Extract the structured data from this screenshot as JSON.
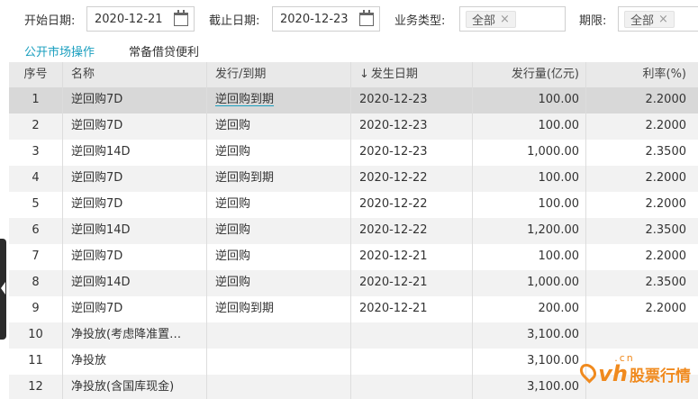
{
  "filters": {
    "start_label": "开始日期:",
    "start_value": "2020-12-21",
    "end_label": "截止日期:",
    "end_value": "2020-12-23",
    "type_label": "业务类型:",
    "type_tag": "全部",
    "term_label": "期限:",
    "term_tag": "全部",
    "tag_remove": "×"
  },
  "tabs": [
    "公开市场操作",
    "常备借贷便利"
  ],
  "table": {
    "sort_arrow": "↓",
    "columns": [
      "序号",
      "名称",
      "发行/到期",
      "发生日期",
      "发行量(亿元)",
      "利率(%)"
    ],
    "rows": [
      [
        "1",
        "逆回购7D",
        "逆回购到期",
        "2020-12-23",
        "100.00",
        "2.2000"
      ],
      [
        "2",
        "逆回购7D",
        "逆回购",
        "2020-12-23",
        "100.00",
        "2.2000"
      ],
      [
        "3",
        "逆回购14D",
        "逆回购",
        "2020-12-23",
        "1,000.00",
        "2.3500"
      ],
      [
        "4",
        "逆回购7D",
        "逆回购到期",
        "2020-12-22",
        "100.00",
        "2.2000"
      ],
      [
        "5",
        "逆回购7D",
        "逆回购",
        "2020-12-22",
        "100.00",
        "2.2000"
      ],
      [
        "6",
        "逆回购14D",
        "逆回购",
        "2020-12-22",
        "1,200.00",
        "2.3500"
      ],
      [
        "7",
        "逆回购7D",
        "逆回购",
        "2020-12-21",
        "100.00",
        "2.2000"
      ],
      [
        "8",
        "逆回购14D",
        "逆回购",
        "2020-12-21",
        "1,000.00",
        "2.3500"
      ],
      [
        "9",
        "逆回购7D",
        "逆回购到期",
        "2020-12-21",
        "200.00",
        "2.2000"
      ],
      [
        "10",
        "净投放(考虑降准置…",
        "",
        "",
        "3,100.00",
        ""
      ],
      [
        "11",
        "净投放",
        "",
        "",
        "3,100.00",
        ""
      ],
      [
        "12",
        "净投放(含国库现金)",
        "",
        "",
        "3,100.00",
        ""
      ]
    ]
  },
  "watermark": {
    "vh": "vh",
    "cn": ".cn",
    "text": "股票行情",
    "color": "#f08a1e"
  },
  "colors": {
    "accent": "#1a9fbf",
    "header_bg": "#e9e9e9",
    "selected_row": "#d8d8d8",
    "striped_row": "#f2f2f2"
  }
}
